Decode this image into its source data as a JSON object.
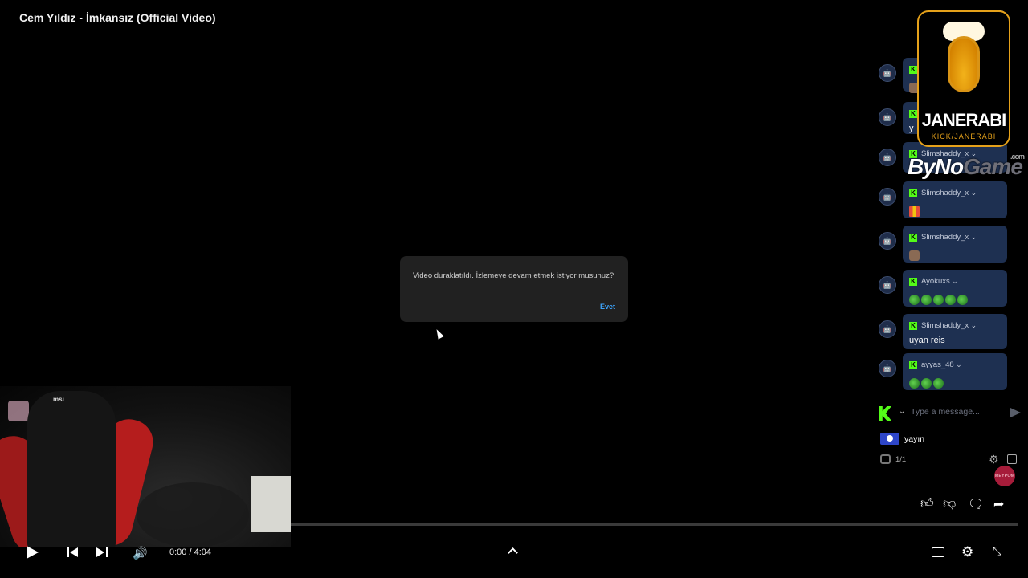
{
  "video": {
    "title": "Cem Yıldız - İmkansız (Official Video)",
    "time": "0:00 / 4:04"
  },
  "dialog": {
    "message": "Video duraklatıldı. İzlemeye devam etmek istiyor musunuz?",
    "confirm": "Evet"
  },
  "webcam": {
    "chair_brand": "msi"
  },
  "chat": {
    "messages": [
      {
        "user": "",
        "text": ""
      },
      {
        "user": "",
        "text": "y"
      },
      {
        "user": "Slimshaddy_x",
        "text": ""
      },
      {
        "user": "Slimshaddy_x",
        "text": ""
      },
      {
        "user": "Slimshaddy_x",
        "text": ""
      },
      {
        "user": "Ayokuxs",
        "text": ""
      },
      {
        "user": "Slimshaddy_x",
        "text": "uyan reis"
      },
      {
        "user": "ayyas_48",
        "text": ""
      }
    ],
    "input_placeholder": "Type a message...",
    "stream_label": "yayın",
    "pager": "1/1",
    "avatar_text": "MEYPOM"
  },
  "watermark": {
    "brand": "JANERABI",
    "sub": "KICK/JANERABI",
    "partner_a": "ByNo",
    "partner_b": "Game",
    "partner_suffix": ".com"
  },
  "colors": {
    "kick_green": "#53fc18",
    "link_blue": "#3ea6ff",
    "bubble": "#1e3051"
  }
}
